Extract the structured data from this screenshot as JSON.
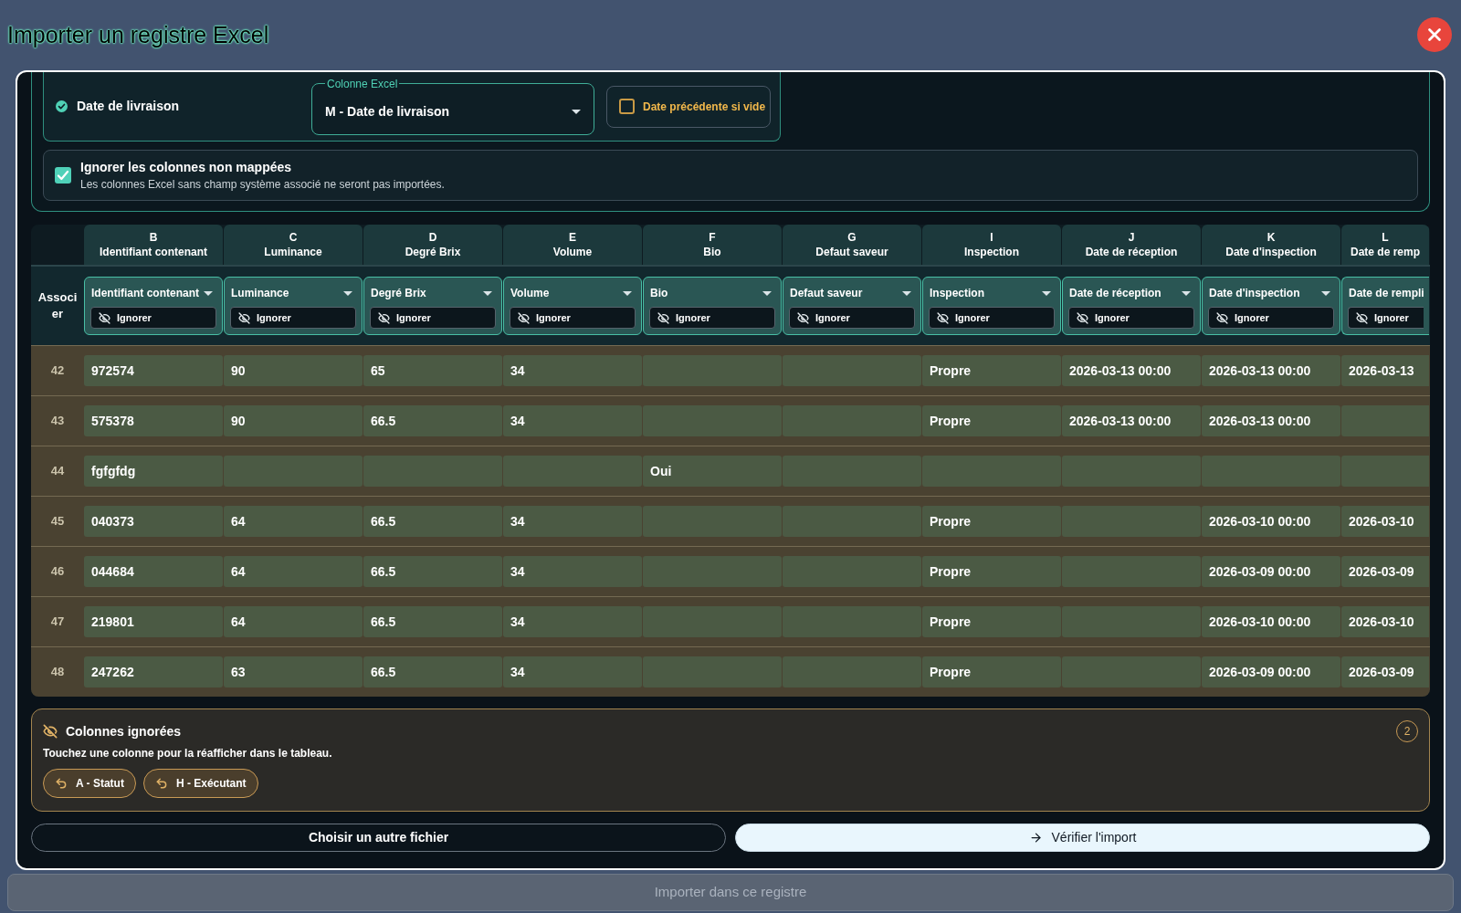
{
  "title": "Importer un registre Excel",
  "mapping_panel": {
    "field": {
      "label": "Date de livraison",
      "mapped": true
    },
    "excel_column": {
      "legend": "Colonne Excel",
      "value": "M - Date de livraison"
    },
    "fallback_option": {
      "label": "Date précédente si vide",
      "checked": false
    },
    "ignore_unmapped": {
      "title": "Ignorer les colonnes non mappées",
      "description": "Les colonnes Excel sans champ système associé ne seront pas importées.",
      "checked": true
    }
  },
  "table": {
    "associate_label": "Associer",
    "columns": [
      {
        "letter": "B",
        "name": "Identifiant contenant",
        "mapping": "Identifiant contenant",
        "ignore_label": "Ignorer",
        "cut_off": false
      },
      {
        "letter": "C",
        "name": "Luminance",
        "mapping": "Luminance",
        "ignore_label": "Ignorer",
        "cut_off": false
      },
      {
        "letter": "D",
        "name": "Degré Brix",
        "mapping": "Degré Brix",
        "ignore_label": "Ignorer",
        "cut_off": false
      },
      {
        "letter": "E",
        "name": "Volume",
        "mapping": "Volume",
        "ignore_label": "Ignorer",
        "cut_off": false
      },
      {
        "letter": "F",
        "name": "Bio",
        "mapping": "Bio",
        "ignore_label": "Ignorer",
        "cut_off": false
      },
      {
        "letter": "G",
        "name": "Defaut saveur",
        "mapping": "Defaut saveur",
        "ignore_label": "Ignorer",
        "cut_off": false
      },
      {
        "letter": "I",
        "name": "Inspection",
        "mapping": "Inspection",
        "ignore_label": "Ignorer",
        "cut_off": false
      },
      {
        "letter": "J",
        "name": "Date de réception",
        "mapping": "Date de réception",
        "ignore_label": "Ignorer",
        "cut_off": false
      },
      {
        "letter": "K",
        "name": "Date d'inspection",
        "mapping": "Date d'inspection",
        "ignore_label": "Ignorer",
        "cut_off": false
      },
      {
        "letter": "L",
        "name": "Date de remp",
        "mapping": "Date de rempli",
        "ignore_label": "Ignorer",
        "cut_off": true
      }
    ],
    "rows": [
      {
        "number": "42",
        "cells": [
          "972574",
          "90",
          "65",
          "34",
          null,
          null,
          "Propre",
          "2026-03-13 00:00",
          "2026-03-13 00:00",
          "2026-03-13"
        ]
      },
      {
        "number": "43",
        "cells": [
          "575378",
          "90",
          "66.5",
          "34",
          null,
          null,
          "Propre",
          "2026-03-13 00:00",
          "2026-03-13 00:00",
          null
        ]
      },
      {
        "number": "44",
        "cells": [
          "fgfgfdg",
          null,
          null,
          null,
          "Oui",
          null,
          null,
          null,
          null,
          null
        ]
      },
      {
        "number": "45",
        "cells": [
          "040373",
          "64",
          "66.5",
          "34",
          null,
          null,
          "Propre",
          null,
          "2026-03-10 00:00",
          "2026-03-10"
        ]
      },
      {
        "number": "46",
        "cells": [
          "044684",
          "64",
          "66.5",
          "34",
          null,
          null,
          "Propre",
          null,
          "2026-03-09 00:00",
          "2026-03-09"
        ]
      },
      {
        "number": "47",
        "cells": [
          "219801",
          "64",
          "66.5",
          "34",
          null,
          null,
          "Propre",
          null,
          "2026-03-10 00:00",
          "2026-03-10"
        ]
      },
      {
        "number": "48",
        "cells": [
          "247262",
          "63",
          "66.5",
          "34",
          null,
          null,
          "Propre",
          null,
          "2026-03-09 00:00",
          "2026-03-09"
        ]
      }
    ]
  },
  "ignored_columns": {
    "title": "Colonnes ignorées",
    "count": "2",
    "hint": "Touchez une colonne pour la réafficher dans le tableau.",
    "items": [
      "A - Statut",
      "H - Exécutant"
    ]
  },
  "actions": {
    "choose_file": "Choisir un autre fichier",
    "verify": "Vérifier l'import"
  },
  "import_button": {
    "label": "Importer dans ce registre",
    "disabled": true
  }
}
